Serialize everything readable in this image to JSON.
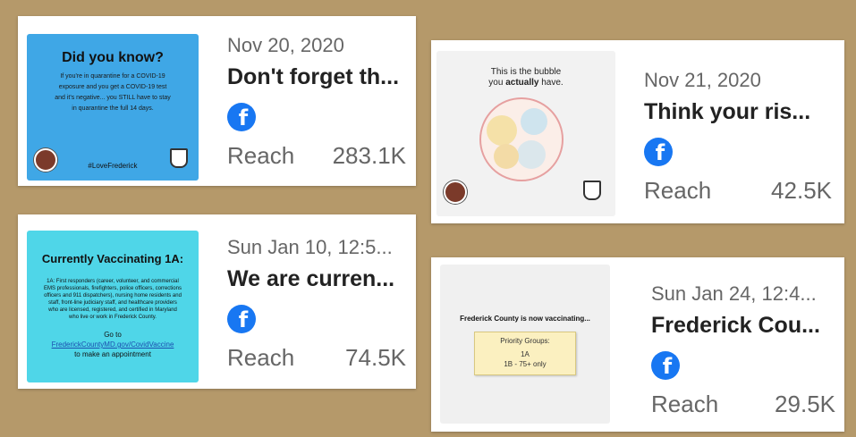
{
  "cards": [
    {
      "date": "Nov 20, 2020",
      "headline": "Don't forget th...",
      "reach_label": "Reach",
      "reach_value": "283.1K",
      "thumb": {
        "heading": "Did you know?",
        "body": "If you're in quarantine for a COVID-19 exposure and you get a COVID-19 test and it's negative... you STILL have to stay in quarantine the full 14 days.",
        "hashtag": "#LoveFrederick",
        "bg": "#3fa7e6"
      }
    },
    {
      "date": "Nov 21, 2020",
      "headline": "Think your ris...",
      "reach_label": "Reach",
      "reach_value": "42.5K",
      "thumb": {
        "caption_line1": "This is the bubble",
        "caption_line2_pre": "you ",
        "caption_line2_em": "actually",
        "caption_line2_post": " have."
      }
    },
    {
      "date": "Sun Jan 10, 12:5...",
      "headline": "We are curren...",
      "reach_label": "Reach",
      "reach_value": "74.5K",
      "thumb": {
        "heading": "Currently Vaccinating 1A:",
        "body": "1A: First responders (career, volunteer, and commercial EMS professionals, firefighters, police officers, corrections officers and 911 dispatchers), nursing home residents and staff, front-line judiciary staff, and healthcare providers who are licensed, registered, and certified in Maryland who live or work in Frederick County.",
        "goto": "Go to",
        "link": "FrederickCountyMD.gov/CovidVaccine",
        "cta": "to make an appointment",
        "bg": "#4fd6e8"
      }
    },
    {
      "date": "Sun Jan 24, 12:4...",
      "headline": "Frederick Cou...",
      "reach_label": "Reach",
      "reach_value": "29.5K",
      "thumb": {
        "heading": "Frederick County is now vaccinating...",
        "note_title": "Priority Groups:",
        "note_line1": "1A",
        "note_line2": "1B - 75+ only"
      }
    }
  ],
  "colors": {
    "background": "#b5996a",
    "facebook": "#1877f2"
  },
  "icons": {
    "platform": "facebook-icon"
  }
}
